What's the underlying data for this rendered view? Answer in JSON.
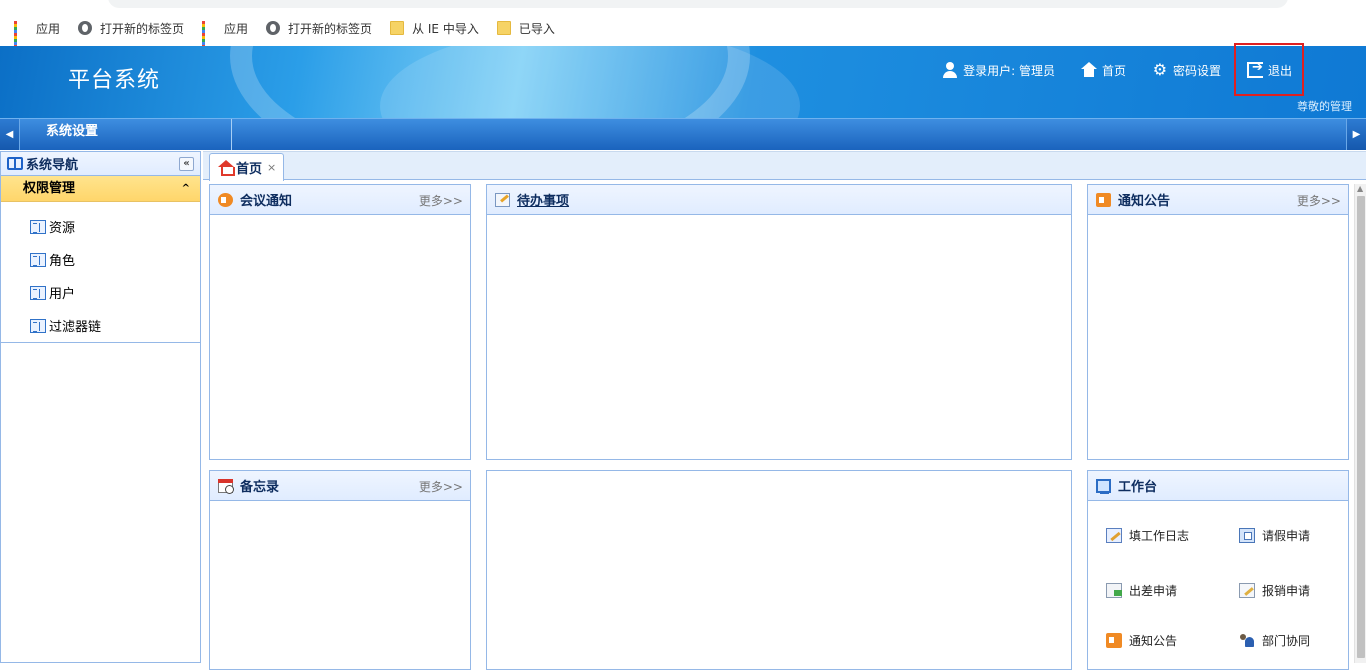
{
  "bookmarks": [
    {
      "label": "应用",
      "icon": "apps-grid-icon"
    },
    {
      "label": "打开新的标签页",
      "icon": "globe-icon"
    },
    {
      "label": "应用",
      "icon": "apps-grid-icon"
    },
    {
      "label": "打开新的标签页",
      "icon": "globe-icon"
    },
    {
      "label": "从 IE 中导入",
      "icon": "folder-icon"
    },
    {
      "label": "已导入",
      "icon": "folder-icon"
    }
  ],
  "header": {
    "title": "平台系统",
    "login_user": "登录用户: 管理员",
    "home": "首页",
    "password_settings": "密码设置",
    "logout": "退出",
    "welcome": "尊敬的管理"
  },
  "module_bar": {
    "item": "系统设置"
  },
  "sidebar": {
    "title": "系统导航",
    "collapse_glyph": "«",
    "group": "权限管理",
    "items": [
      "资源",
      "角色",
      "用户",
      "过滤器链"
    ]
  },
  "tabs": {
    "home_label": "首页",
    "close_glyph": "×"
  },
  "panels": {
    "meeting": {
      "title": "会议通知",
      "more": "更多>>"
    },
    "todo": {
      "title": "待办事项"
    },
    "notice": {
      "title": "通知公告",
      "more": "更多>>"
    },
    "memo": {
      "title": "备忘录",
      "more": "更多>>"
    },
    "workbench": {
      "title": "工作台",
      "items": [
        "填工作日志",
        "请假申请",
        "出差申请",
        "报销申请",
        "通知公告",
        "部门协同"
      ]
    }
  },
  "colors": {
    "header_blue": "#1e8fe0",
    "panel_border": "#95b8e7",
    "group_highlight": "#ffd66b",
    "logout_highlight": "#e02020"
  }
}
